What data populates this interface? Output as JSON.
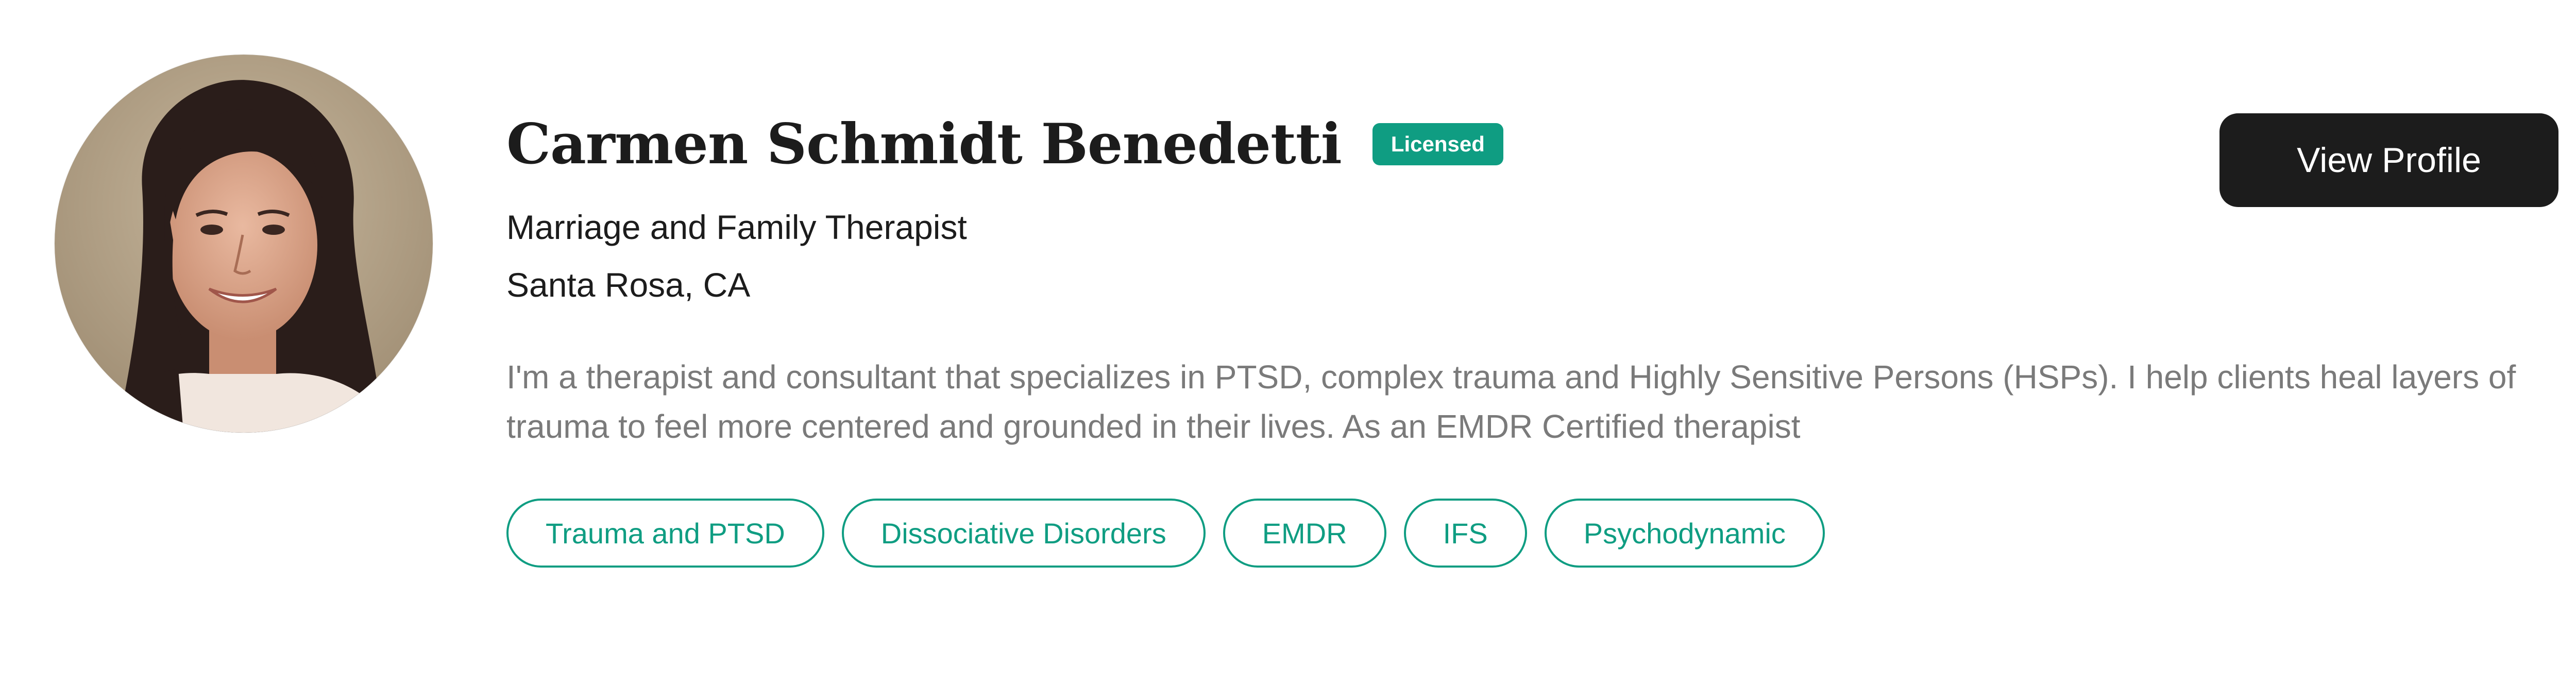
{
  "profile": {
    "name": "Carmen Schmidt Benedetti",
    "badge": "Licensed",
    "title": "Marriage and Family Therapist",
    "location": "Santa Rosa, CA",
    "bio": "I'm a therapist and consultant that specializes in PTSD, complex trauma and Highly Sensitive Persons (HSPs). I help clients heal layers of trauma to feel more centered and grounded in their lives. As an EMDR Certified therapist",
    "avatar_icon": "therapist-photo",
    "tags": [
      "Trauma and PTSD",
      "Dissociative Disorders",
      "EMDR",
      "IFS",
      "Psychodynamic"
    ]
  },
  "actions": {
    "view_profile_label": "View Profile"
  },
  "colors": {
    "accent": "#0f9d82",
    "button_bg": "#1c1c1c",
    "name_text": "#1c1c1c",
    "bio_text": "#7a7a7a"
  }
}
